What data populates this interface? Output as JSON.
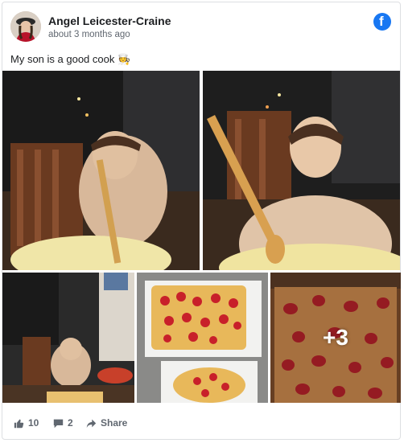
{
  "post": {
    "author": "Angel Leicester-Craine",
    "time": "about 3 months ago",
    "message": "My son is a good cook",
    "message_emoji": "🧑‍🍳"
  },
  "photos": {
    "more_count": "+3"
  },
  "actions": {
    "like_count": "10",
    "comment_count": "2",
    "share_label": "Share"
  },
  "brand": {
    "facebook_color": "#1877f2",
    "icon": "facebook-icon"
  },
  "icons": [
    "facebook-icon",
    "like-icon",
    "comment-icon",
    "share-icon"
  ]
}
